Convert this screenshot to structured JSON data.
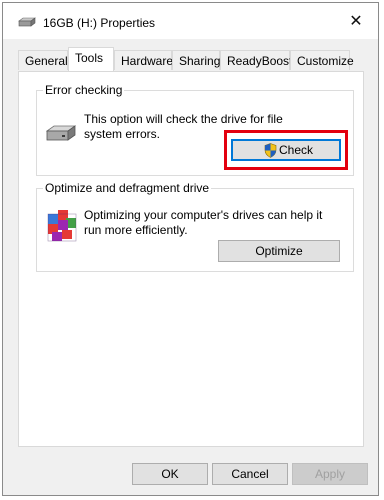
{
  "window": {
    "title": "16GB (H:) Properties",
    "close_symbol": "✕"
  },
  "tabs": [
    {
      "label": "General"
    },
    {
      "label": "Tools"
    },
    {
      "label": "Hardware"
    },
    {
      "label": "Sharing"
    },
    {
      "label": "ReadyBoost"
    },
    {
      "label": "Customize"
    }
  ],
  "active_tab": "Tools",
  "error_checking": {
    "title": "Error checking",
    "description": "This option will check the drive for file system errors.",
    "button_label": "Check",
    "icon": "drive-icon",
    "button_icon": "uac-shield-icon"
  },
  "optimize": {
    "title": "Optimize and defragment drive",
    "description": "Optimizing your computer's drives can help it run more efficiently.",
    "button_label": "Optimize",
    "icon": "defrag-icon"
  },
  "footer": {
    "ok_label": "OK",
    "cancel_label": "Cancel",
    "apply_label": "Apply"
  },
  "colors": {
    "highlight": "#e3000f",
    "focus_border": "#0078d7"
  }
}
